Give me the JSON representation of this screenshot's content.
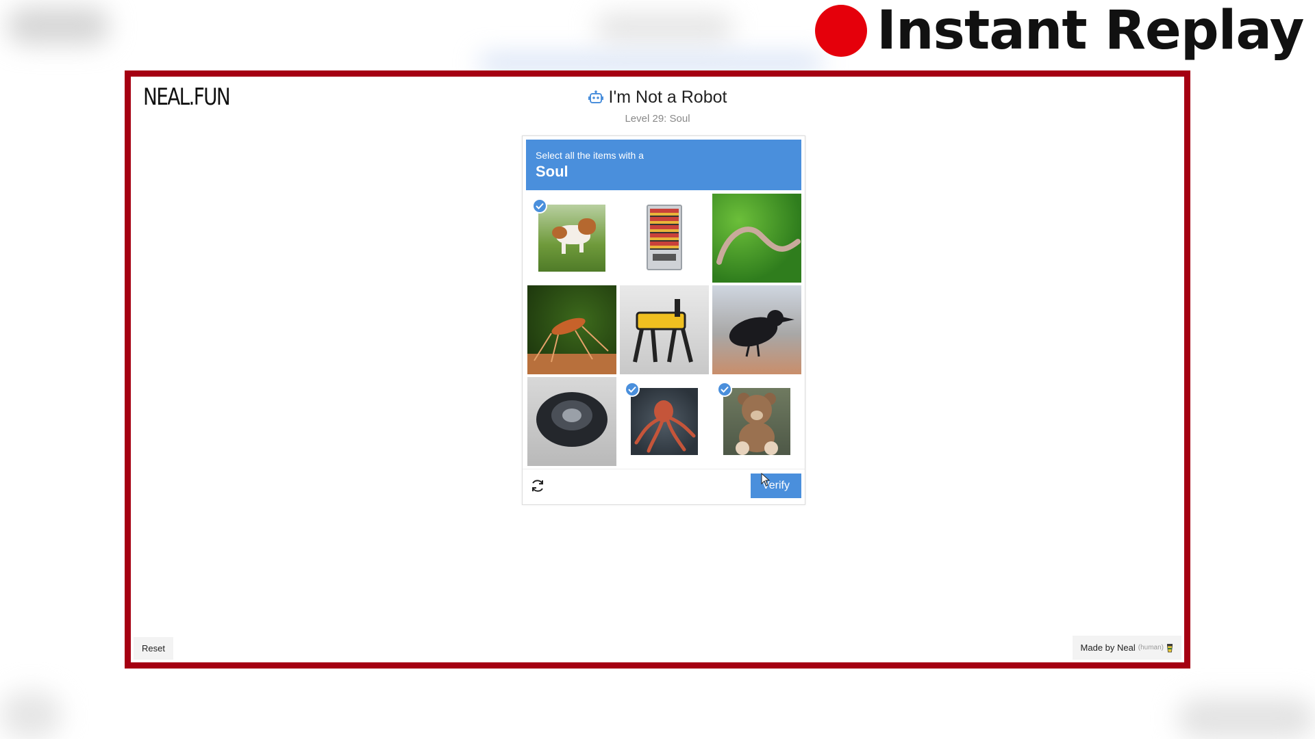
{
  "overlay": {
    "replay_label": "Instant Replay"
  },
  "site": {
    "logo": "NEAL.FUN"
  },
  "header": {
    "title": "I'm Not a Robot",
    "level": "Level 29: Soul"
  },
  "captcha": {
    "instruction": "Select all the items with a",
    "target": "Soul",
    "tiles": [
      {
        "name": "dog",
        "selected": true
      },
      {
        "name": "vending-machine",
        "selected": false
      },
      {
        "name": "worm",
        "selected": false
      },
      {
        "name": "mosquito",
        "selected": false
      },
      {
        "name": "robot-dog",
        "selected": false
      },
      {
        "name": "crow",
        "selected": false
      },
      {
        "name": "robot-vacuum",
        "selected": false
      },
      {
        "name": "octopus",
        "selected": true
      },
      {
        "name": "teddy-bear",
        "selected": true
      }
    ],
    "verify_label": "Verify"
  },
  "footer": {
    "reset_label": "Reset",
    "made_by": "Made by Neal",
    "human_tag": "(human)"
  },
  "colors": {
    "accent": "#4a8fdc",
    "frame": "#a50012",
    "record": "#e5000b"
  }
}
